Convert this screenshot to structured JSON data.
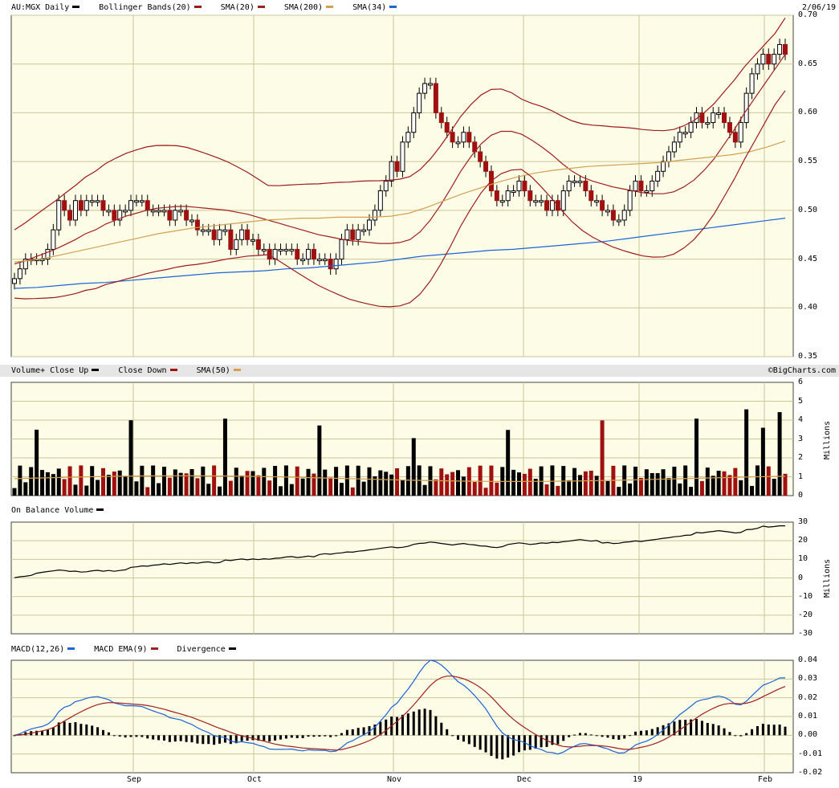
{
  "price_panel": {
    "ticker_label": "AU:MGX Daily",
    "date": "2/06/19",
    "legend": [
      {
        "label": "Bollinger Bands(20)",
        "color": "#9c1c1c"
      },
      {
        "label": "SMA(20)",
        "color": "#a02020"
      },
      {
        "label": "SMA(200)",
        "color": "#d4a050"
      },
      {
        "label": "SMA(34)",
        "color": "#1c64d8"
      }
    ],
    "yticks": [
      "0.70",
      "0.65",
      "0.60",
      "0.55",
      "0.50",
      "0.45",
      "0.40",
      "0.35"
    ],
    "ylim": [
      0.35,
      0.7
    ]
  },
  "volume_panel": {
    "legend": [
      {
        "label": "Volume+ Close Up",
        "color": "#000000"
      },
      {
        "label": "Close Down",
        "color": "#a01010"
      },
      {
        "label": "SMA(50)",
        "color": "#d4a050"
      }
    ],
    "brand": "©BigCharts.com",
    "yticks": [
      "6",
      "5",
      "4",
      "3",
      "2",
      "1",
      "0"
    ],
    "unit": "Millions"
  },
  "obv_panel": {
    "legend": [
      {
        "label": "On Balance Volume",
        "color": "#000000"
      }
    ],
    "yticks": [
      "30",
      "20",
      "10",
      "0",
      "-10",
      "-20",
      "-30"
    ],
    "unit": "Millions"
  },
  "macd_panel": {
    "legend": [
      {
        "label": "MACD(12,26)",
        "color": "#1c64d8"
      },
      {
        "label": "MACD EMA(9)",
        "color": "#a02020"
      },
      {
        "label": "Divergence",
        "color": "#000000"
      }
    ],
    "yticks": [
      "0.04",
      "0.03",
      "0.02",
      "0.01",
      "0.00",
      "-0.01",
      "-0.02"
    ]
  },
  "x_axis": {
    "labels": [
      "Sep",
      "Oct",
      "Nov",
      "Dec",
      "19",
      "Feb"
    ]
  },
  "chart_data": {
    "type": "candlestick",
    "ylim": [
      0.35,
      0.7
    ],
    "series": [
      {
        "name": "AU:MGX Daily",
        "close": [
          0.43,
          0.44,
          0.45,
          0.45,
          0.45,
          0.45,
          0.46,
          0.48,
          0.51,
          0.5,
          0.49,
          0.51,
          0.5,
          0.51,
          0.51,
          0.51,
          0.5,
          0.5,
          0.49,
          0.5,
          0.5,
          0.51,
          0.51,
          0.51,
          0.5,
          0.5,
          0.5,
          0.5,
          0.49,
          0.5,
          0.5,
          0.49,
          0.49,
          0.48,
          0.48,
          0.48,
          0.47,
          0.48,
          0.48,
          0.46,
          0.47,
          0.48,
          0.47,
          0.47,
          0.46,
          0.46,
          0.45,
          0.46,
          0.46,
          0.46,
          0.46,
          0.45,
          0.45,
          0.46,
          0.45,
          0.45,
          0.45,
          0.44,
          0.45,
          0.47,
          0.48,
          0.47,
          0.48,
          0.48,
          0.49,
          0.5,
          0.52,
          0.53,
          0.55,
          0.54,
          0.57,
          0.58,
          0.6,
          0.62,
          0.63,
          0.63,
          0.6,
          0.59,
          0.58,
          0.57,
          0.57,
          0.58,
          0.57,
          0.56,
          0.55,
          0.54,
          0.52,
          0.51,
          0.51,
          0.52,
          0.52,
          0.53,
          0.52,
          0.51,
          0.51,
          0.51,
          0.5,
          0.51,
          0.5,
          0.52,
          0.53,
          0.53,
          0.53,
          0.52,
          0.51,
          0.51,
          0.5,
          0.5,
          0.49,
          0.49,
          0.5,
          0.52,
          0.53,
          0.52,
          0.52,
          0.53,
          0.54,
          0.55,
          0.56,
          0.57,
          0.58,
          0.58,
          0.59,
          0.6,
          0.59,
          0.59,
          0.6,
          0.6,
          0.59,
          0.58,
          0.57,
          0.59,
          0.62,
          0.64,
          0.65,
          0.66,
          0.65,
          0.66,
          0.67,
          0.66
        ]
      },
      {
        "name": "SMA(20)",
        "values": [
          0.445,
          0.448,
          0.452,
          0.456,
          0.46,
          0.465,
          0.47,
          0.476,
          0.48,
          0.486,
          0.49,
          0.494,
          0.497,
          0.5,
          0.502,
          0.503,
          0.504,
          0.504,
          0.503,
          0.502,
          0.501,
          0.5,
          0.498,
          0.496,
          0.493,
          0.49,
          0.487,
          0.484,
          0.481,
          0.478,
          0.475,
          0.473,
          0.471,
          0.469,
          0.468,
          0.467,
          0.466,
          0.466,
          0.467,
          0.47,
          0.478,
          0.49,
          0.505,
          0.522,
          0.54,
          0.555,
          0.568,
          0.577,
          0.581,
          0.581,
          0.578,
          0.572,
          0.565,
          0.557,
          0.548,
          0.54,
          0.534,
          0.53,
          0.527,
          0.524,
          0.522,
          0.52,
          0.518,
          0.517,
          0.517,
          0.519,
          0.524,
          0.531,
          0.541,
          0.553,
          0.568,
          0.583,
          0.6,
          0.615,
          0.63,
          0.645,
          0.66
        ]
      },
      {
        "name": "SMA(200)",
        "values": [
          0.447,
          0.449,
          0.452,
          0.456,
          0.46,
          0.464,
          0.468,
          0.472,
          0.476,
          0.479,
          0.482,
          0.484,
          0.486,
          0.488,
          0.49,
          0.491,
          0.492,
          0.492,
          0.493,
          0.493,
          0.493,
          0.494,
          0.497,
          0.503,
          0.51,
          0.517,
          0.523,
          0.529,
          0.534,
          0.538,
          0.541,
          0.543,
          0.545,
          0.546,
          0.547,
          0.548,
          0.549,
          0.551,
          0.553,
          0.555,
          0.557,
          0.56,
          0.565,
          0.571
        ]
      },
      {
        "name": "SMA(34)",
        "values": [
          0.42,
          0.421,
          0.423,
          0.425,
          0.426,
          0.428,
          0.43,
          0.432,
          0.434,
          0.436,
          0.437,
          0.438,
          0.44,
          0.441,
          0.443,
          0.445,
          0.447,
          0.45,
          0.453,
          0.455,
          0.457,
          0.459,
          0.46,
          0.462,
          0.464,
          0.466,
          0.468,
          0.471,
          0.474,
          0.477,
          0.48,
          0.483,
          0.486,
          0.489,
          0.492
        ]
      }
    ],
    "volume": {
      "unit": "Millions",
      "ylim": [
        0,
        6
      ]
    },
    "macd": {
      "ylim": [
        -0.02,
        0.04
      ]
    },
    "obv": {
      "ylim": [
        -30,
        30
      ],
      "unit": "Millions"
    }
  },
  "colors": {
    "panel_bg": "#fdfce6",
    "grid": "#c8c89a",
    "up": "#ffffff",
    "down": "#a01010",
    "bb": "#9c1c1c",
    "sma20": "#a02020",
    "sma200": "#d4a050",
    "sma34": "#1c64d8",
    "macd": "#1c64d8",
    "ema": "#a02020"
  }
}
